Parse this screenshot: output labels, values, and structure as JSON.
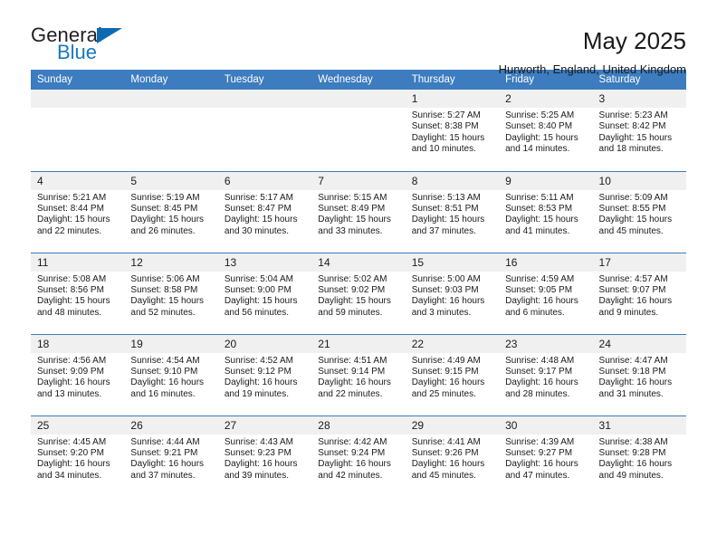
{
  "brand": {
    "name_part1": "General",
    "name_part2": "Blue",
    "accent_color": "#1878be",
    "triangle_color": "#0d6ab2"
  },
  "header": {
    "title": "May 2025",
    "location": "Hurworth, England, United Kingdom"
  },
  "calendar": {
    "header_bg": "#3c7cbf",
    "daynum_bg": "#f0f0f0",
    "weekday_headers": [
      "Sunday",
      "Monday",
      "Tuesday",
      "Wednesday",
      "Thursday",
      "Friday",
      "Saturday"
    ],
    "weeks": [
      [
        {
          "day": "",
          "sunrise": "",
          "sunset": "",
          "daylight_line1": "",
          "daylight_line2": ""
        },
        {
          "day": "",
          "sunrise": "",
          "sunset": "",
          "daylight_line1": "",
          "daylight_line2": ""
        },
        {
          "day": "",
          "sunrise": "",
          "sunset": "",
          "daylight_line1": "",
          "daylight_line2": ""
        },
        {
          "day": "",
          "sunrise": "",
          "sunset": "",
          "daylight_line1": "",
          "daylight_line2": ""
        },
        {
          "day": "1",
          "sunrise": "Sunrise: 5:27 AM",
          "sunset": "Sunset: 8:38 PM",
          "daylight_line1": "Daylight: 15 hours",
          "daylight_line2": "and 10 minutes."
        },
        {
          "day": "2",
          "sunrise": "Sunrise: 5:25 AM",
          "sunset": "Sunset: 8:40 PM",
          "daylight_line1": "Daylight: 15 hours",
          "daylight_line2": "and 14 minutes."
        },
        {
          "day": "3",
          "sunrise": "Sunrise: 5:23 AM",
          "sunset": "Sunset: 8:42 PM",
          "daylight_line1": "Daylight: 15 hours",
          "daylight_line2": "and 18 minutes."
        }
      ],
      [
        {
          "day": "4",
          "sunrise": "Sunrise: 5:21 AM",
          "sunset": "Sunset: 8:44 PM",
          "daylight_line1": "Daylight: 15 hours",
          "daylight_line2": "and 22 minutes."
        },
        {
          "day": "5",
          "sunrise": "Sunrise: 5:19 AM",
          "sunset": "Sunset: 8:45 PM",
          "daylight_line1": "Daylight: 15 hours",
          "daylight_line2": "and 26 minutes."
        },
        {
          "day": "6",
          "sunrise": "Sunrise: 5:17 AM",
          "sunset": "Sunset: 8:47 PM",
          "daylight_line1": "Daylight: 15 hours",
          "daylight_line2": "and 30 minutes."
        },
        {
          "day": "7",
          "sunrise": "Sunrise: 5:15 AM",
          "sunset": "Sunset: 8:49 PM",
          "daylight_line1": "Daylight: 15 hours",
          "daylight_line2": "and 33 minutes."
        },
        {
          "day": "8",
          "sunrise": "Sunrise: 5:13 AM",
          "sunset": "Sunset: 8:51 PM",
          "daylight_line1": "Daylight: 15 hours",
          "daylight_line2": "and 37 minutes."
        },
        {
          "day": "9",
          "sunrise": "Sunrise: 5:11 AM",
          "sunset": "Sunset: 8:53 PM",
          "daylight_line1": "Daylight: 15 hours",
          "daylight_line2": "and 41 minutes."
        },
        {
          "day": "10",
          "sunrise": "Sunrise: 5:09 AM",
          "sunset": "Sunset: 8:55 PM",
          "daylight_line1": "Daylight: 15 hours",
          "daylight_line2": "and 45 minutes."
        }
      ],
      [
        {
          "day": "11",
          "sunrise": "Sunrise: 5:08 AM",
          "sunset": "Sunset: 8:56 PM",
          "daylight_line1": "Daylight: 15 hours",
          "daylight_line2": "and 48 minutes."
        },
        {
          "day": "12",
          "sunrise": "Sunrise: 5:06 AM",
          "sunset": "Sunset: 8:58 PM",
          "daylight_line1": "Daylight: 15 hours",
          "daylight_line2": "and 52 minutes."
        },
        {
          "day": "13",
          "sunrise": "Sunrise: 5:04 AM",
          "sunset": "Sunset: 9:00 PM",
          "daylight_line1": "Daylight: 15 hours",
          "daylight_line2": "and 56 minutes."
        },
        {
          "day": "14",
          "sunrise": "Sunrise: 5:02 AM",
          "sunset": "Sunset: 9:02 PM",
          "daylight_line1": "Daylight: 15 hours",
          "daylight_line2": "and 59 minutes."
        },
        {
          "day": "15",
          "sunrise": "Sunrise: 5:00 AM",
          "sunset": "Sunset: 9:03 PM",
          "daylight_line1": "Daylight: 16 hours",
          "daylight_line2": "and 3 minutes."
        },
        {
          "day": "16",
          "sunrise": "Sunrise: 4:59 AM",
          "sunset": "Sunset: 9:05 PM",
          "daylight_line1": "Daylight: 16 hours",
          "daylight_line2": "and 6 minutes."
        },
        {
          "day": "17",
          "sunrise": "Sunrise: 4:57 AM",
          "sunset": "Sunset: 9:07 PM",
          "daylight_line1": "Daylight: 16 hours",
          "daylight_line2": "and 9 minutes."
        }
      ],
      [
        {
          "day": "18",
          "sunrise": "Sunrise: 4:56 AM",
          "sunset": "Sunset: 9:09 PM",
          "daylight_line1": "Daylight: 16 hours",
          "daylight_line2": "and 13 minutes."
        },
        {
          "day": "19",
          "sunrise": "Sunrise: 4:54 AM",
          "sunset": "Sunset: 9:10 PM",
          "daylight_line1": "Daylight: 16 hours",
          "daylight_line2": "and 16 minutes."
        },
        {
          "day": "20",
          "sunrise": "Sunrise: 4:52 AM",
          "sunset": "Sunset: 9:12 PM",
          "daylight_line1": "Daylight: 16 hours",
          "daylight_line2": "and 19 minutes."
        },
        {
          "day": "21",
          "sunrise": "Sunrise: 4:51 AM",
          "sunset": "Sunset: 9:14 PM",
          "daylight_line1": "Daylight: 16 hours",
          "daylight_line2": "and 22 minutes."
        },
        {
          "day": "22",
          "sunrise": "Sunrise: 4:49 AM",
          "sunset": "Sunset: 9:15 PM",
          "daylight_line1": "Daylight: 16 hours",
          "daylight_line2": "and 25 minutes."
        },
        {
          "day": "23",
          "sunrise": "Sunrise: 4:48 AM",
          "sunset": "Sunset: 9:17 PM",
          "daylight_line1": "Daylight: 16 hours",
          "daylight_line2": "and 28 minutes."
        },
        {
          "day": "24",
          "sunrise": "Sunrise: 4:47 AM",
          "sunset": "Sunset: 9:18 PM",
          "daylight_line1": "Daylight: 16 hours",
          "daylight_line2": "and 31 minutes."
        }
      ],
      [
        {
          "day": "25",
          "sunrise": "Sunrise: 4:45 AM",
          "sunset": "Sunset: 9:20 PM",
          "daylight_line1": "Daylight: 16 hours",
          "daylight_line2": "and 34 minutes."
        },
        {
          "day": "26",
          "sunrise": "Sunrise: 4:44 AM",
          "sunset": "Sunset: 9:21 PM",
          "daylight_line1": "Daylight: 16 hours",
          "daylight_line2": "and 37 minutes."
        },
        {
          "day": "27",
          "sunrise": "Sunrise: 4:43 AM",
          "sunset": "Sunset: 9:23 PM",
          "daylight_line1": "Daylight: 16 hours",
          "daylight_line2": "and 39 minutes."
        },
        {
          "day": "28",
          "sunrise": "Sunrise: 4:42 AM",
          "sunset": "Sunset: 9:24 PM",
          "daylight_line1": "Daylight: 16 hours",
          "daylight_line2": "and 42 minutes."
        },
        {
          "day": "29",
          "sunrise": "Sunrise: 4:41 AM",
          "sunset": "Sunset: 9:26 PM",
          "daylight_line1": "Daylight: 16 hours",
          "daylight_line2": "and 45 minutes."
        },
        {
          "day": "30",
          "sunrise": "Sunrise: 4:39 AM",
          "sunset": "Sunset: 9:27 PM",
          "daylight_line1": "Daylight: 16 hours",
          "daylight_line2": "and 47 minutes."
        },
        {
          "day": "31",
          "sunrise": "Sunrise: 4:38 AM",
          "sunset": "Sunset: 9:28 PM",
          "daylight_line1": "Daylight: 16 hours",
          "daylight_line2": "and 49 minutes."
        }
      ]
    ]
  }
}
